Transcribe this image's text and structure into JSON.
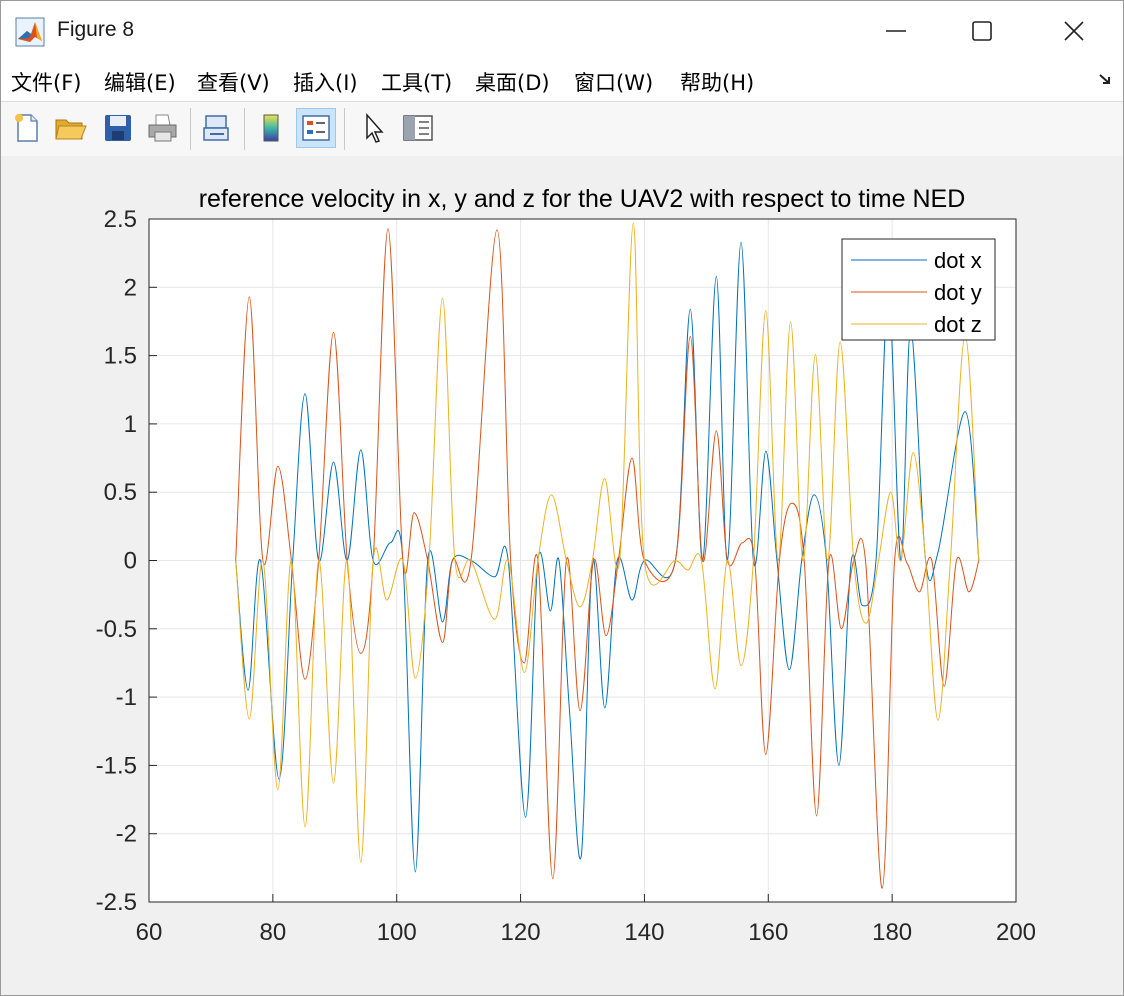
{
  "window": {
    "title": "Figure 8"
  },
  "menu": [
    "文件(F)",
    "编辑(E)",
    "查看(V)",
    "插入(I)",
    "工具(T)",
    "桌面(D)",
    "窗口(W)",
    "帮助(H)"
  ],
  "toolbar": {
    "icons": [
      "new-figure-icon",
      "open-file-icon",
      "save-icon",
      "print-icon",
      "link-plot-icon",
      "colorbar-icon",
      "legend-icon",
      "pointer-icon",
      "property-inspector-icon"
    ]
  },
  "chart_data": {
    "type": "line",
    "title": "reference velocity in x, y and z for the UAV2 with respect to time NED",
    "xlabel": "",
    "ylabel": "",
    "xlim": [
      60,
      200
    ],
    "ylim": [
      -2.5,
      2.5
    ],
    "xticks": [
      "60",
      "80",
      "100",
      "120",
      "140",
      "160",
      "180",
      "200"
    ],
    "yticks": [
      "2.5",
      "2",
      "1.5",
      "1",
      "0.5",
      "0",
      "-0.5",
      "-1",
      "-1.5",
      "-2",
      "-2.5"
    ],
    "grid": true,
    "legend_position": "top-right",
    "series": [
      {
        "name": "dot x",
        "color": "#0072BD",
        "x": [
          74,
          76,
          78,
          81,
          83.2,
          85.2,
          87.4,
          89.8,
          92,
          94.2,
          96.2,
          99,
          101,
          103,
          105,
          107.4,
          109,
          112,
          115.8,
          118,
          120.8,
          122.8,
          124.8,
          126.2,
          127.9,
          129.8,
          131.6,
          133.6,
          135.6,
          138,
          140,
          145,
          147.4,
          149.4,
          151.6,
          153.4,
          155.6,
          157.6,
          159.6,
          161.4,
          163.4,
          165.4,
          167.4,
          169.4,
          171.4,
          173.4,
          175.2,
          177.4,
          179.4,
          181.4,
          183,
          185.4,
          187.4,
          191.8,
          194
        ],
        "y": [
          0,
          -0.95,
          0,
          -1.6,
          0,
          1.22,
          0,
          0.72,
          0,
          0.81,
          0,
          0.13,
          0,
          -2.28,
          0,
          -0.45,
          0,
          0,
          -0.12,
          0,
          -1.88,
          0,
          -0.37,
          0,
          -1.1,
          -2.16,
          0,
          -1.08,
          0,
          -0.29,
          0,
          0,
          1.84,
          0,
          2.08,
          0,
          2.33,
          0,
          0.8,
          0,
          -0.8,
          0,
          0.48,
          0,
          -1.5,
          0,
          -0.33,
          0,
          1.97,
          0,
          1.7,
          0,
          0.06,
          1.09,
          0
        ]
      },
      {
        "name": "dot y",
        "color": "#D95319",
        "x": [
          74,
          76.2,
          78.4,
          80.8,
          83,
          85.2,
          87.4,
          89.8,
          92,
          94.2,
          96.2,
          98.6,
          101,
          102.8,
          105,
          107.4,
          109,
          112,
          116.2,
          118.4,
          120.6,
          122.8,
          125.2,
          127.4,
          129.6,
          131.8,
          133.8,
          135.8,
          138,
          140,
          145,
          147.4,
          149.4,
          151.6,
          153.4,
          155.8,
          157.8,
          159.6,
          161.8,
          163.8,
          165.8,
          167.8,
          169.8,
          171.8,
          173.8,
          175.8,
          178.4,
          180.4,
          182.4,
          184.4,
          186.4,
          188.4,
          190.4,
          192.4,
          194
        ],
        "y": [
          0,
          1.93,
          0,
          0.69,
          0,
          -0.87,
          0,
          1.67,
          0,
          -0.68,
          0,
          2.43,
          0,
          0.35,
          0,
          -0.6,
          0,
          0,
          2.42,
          0,
          -0.75,
          0,
          -2.33,
          0,
          -1.1,
          0,
          -0.55,
          0,
          0.75,
          0,
          0,
          1.64,
          0,
          0.95,
          0,
          0.13,
          0,
          -1.42,
          0,
          0.42,
          0,
          -1.87,
          0,
          -0.5,
          0,
          -0.05,
          -2.4,
          0,
          -0.02,
          -0.23,
          0,
          -0.92,
          0,
          -0.23,
          0
        ]
      },
      {
        "name": "dot z",
        "color": "#EDB120",
        "x": [
          74,
          76.2,
          78.4,
          80.8,
          83,
          85.2,
          87.4,
          89.8,
          92,
          94.2,
          96.2,
          98.4,
          101,
          103,
          105.2,
          107.4,
          109.4,
          112,
          115.8,
          118,
          120.6,
          122.8,
          125,
          127.4,
          129.6,
          131.6,
          133.6,
          136,
          138.2,
          140,
          145,
          147,
          149.2,
          151.4,
          153.4,
          155.6,
          157.6,
          159.6,
          161.6,
          163.6,
          165.6,
          167.6,
          169.6,
          171.6,
          173.8,
          175.8,
          177.8,
          179.8,
          181.4,
          183.4,
          185.4,
          187.4,
          189.4,
          191.8,
          194
        ],
        "y": [
          0,
          -1.16,
          0,
          -1.68,
          0,
          -1.95,
          0,
          -1.63,
          0,
          -2.21,
          0,
          -0.29,
          0,
          -0.86,
          0,
          1.92,
          0,
          0,
          -0.43,
          0,
          -0.82,
          0,
          0.48,
          0,
          -0.34,
          0,
          0.6,
          0,
          2.47,
          0,
          0,
          -0.07,
          0,
          -0.94,
          0,
          -0.77,
          0,
          1.83,
          0,
          1.75,
          0,
          1.51,
          0,
          1.6,
          0,
          -0.46,
          0,
          0.5,
          0,
          0.79,
          0,
          -1.17,
          0,
          1.65,
          0
        ]
      }
    ]
  }
}
